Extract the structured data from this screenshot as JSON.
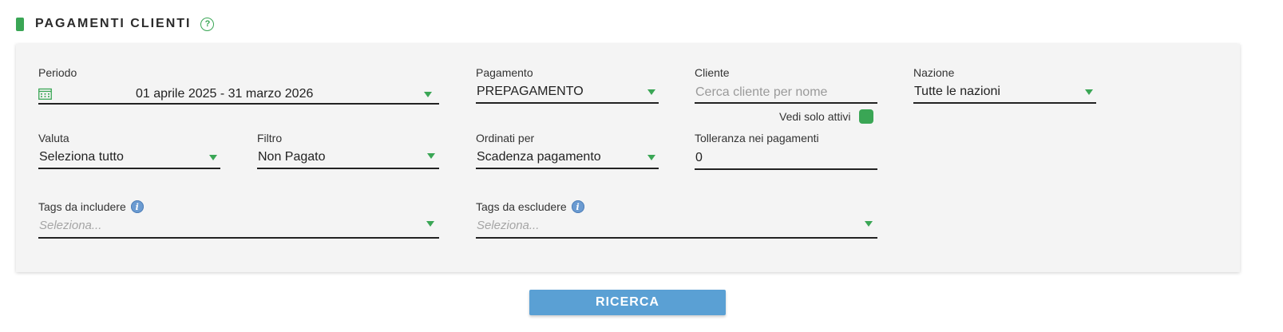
{
  "header": {
    "title": "PAGAMENTI CLIENTI",
    "help_symbol": "?"
  },
  "filters": {
    "periodo": {
      "label": "Periodo",
      "value": "01 aprile 2025 - 31 marzo 2026",
      "icon": "calendar-icon"
    },
    "pagamento": {
      "label": "Pagamento",
      "value": "PREPAGAMENTO"
    },
    "cliente": {
      "label": "Cliente",
      "placeholder": "Cerca cliente per nome",
      "value": ""
    },
    "vedi_solo_attivi": {
      "label": "Vedi solo attivi",
      "checked": true
    },
    "nazione": {
      "label": "Nazione",
      "value": "Tutte le nazioni"
    },
    "valuta": {
      "label": "Valuta",
      "value": "Seleziona tutto"
    },
    "filtro": {
      "label": "Filtro",
      "value": "Non Pagato"
    },
    "ordinati_per": {
      "label": "Ordinati per",
      "value": "Scadenza pagamento"
    },
    "tolleranza": {
      "label": "Tolleranza nei pagamenti",
      "value": "0"
    },
    "tags_includere": {
      "label": "Tags da includere",
      "placeholder": "Seleziona...",
      "info_symbol": "i"
    },
    "tags_escludere": {
      "label": "Tags da escludere",
      "placeholder": "Seleziona...",
      "info_symbol": "i"
    }
  },
  "actions": {
    "search_label": "RICERCA"
  },
  "colors": {
    "accent_green": "#3aa655",
    "button_blue": "#5aa0d4",
    "panel_bg": "#f4f4f4",
    "info_blue": "#6b9bd1"
  }
}
